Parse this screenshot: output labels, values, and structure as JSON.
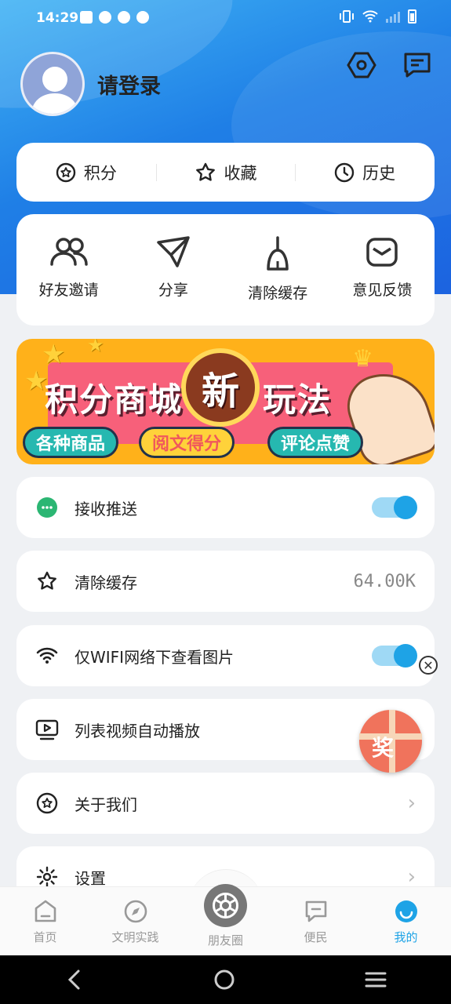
{
  "status_bar": {
    "time": "14:29"
  },
  "profile": {
    "login_text": "请登录"
  },
  "header_icons": [
    "hexagon-settings-icon",
    "message-icon"
  ],
  "quick_tabs": [
    {
      "label": "积分",
      "icon": "star-circle-icon"
    },
    {
      "label": "收藏",
      "icon": "star-icon"
    },
    {
      "label": "历史",
      "icon": "clock-icon"
    }
  ],
  "grid": [
    {
      "label": "好友邀请",
      "icon": "friends-icon"
    },
    {
      "label": "分享",
      "icon": "send-icon"
    },
    {
      "label": "清除缓存",
      "icon": "broom-icon"
    },
    {
      "label": "意见反馈",
      "icon": "mail-bag-icon"
    }
  ],
  "banner": {
    "title_left": "积分商城",
    "title_badge": "新",
    "title_right": "玩法",
    "pills": [
      "各种商品",
      "阅文得分",
      "评论点赞"
    ]
  },
  "settings": [
    {
      "label": "接收推送",
      "icon": "chat-bubble-icon",
      "type": "toggle",
      "on": true
    },
    {
      "label": "清除缓存",
      "icon": "star-icon",
      "type": "value",
      "value": "64.00K"
    },
    {
      "label": "仅WIFI网络下查看图片",
      "icon": "wifi-icon",
      "type": "toggle",
      "on": true
    },
    {
      "label": "列表视频自动播放",
      "icon": "video-icon",
      "type": "none"
    },
    {
      "label": "关于我们",
      "icon": "star-circle-icon",
      "type": "chevron"
    },
    {
      "label": "设置",
      "icon": "gear-icon",
      "type": "chevron"
    }
  ],
  "floating_gift": {
    "label": "奖"
  },
  "tabbar": [
    {
      "label": "首页",
      "icon": "home-icon",
      "active": false
    },
    {
      "label": "文明实践",
      "icon": "compass-icon",
      "active": false
    },
    {
      "label": "朋友圈",
      "icon": "camera-aperture-icon",
      "active": false
    },
    {
      "label": "便民",
      "icon": "message-dots-icon",
      "active": false
    },
    {
      "label": "我的",
      "icon": "smile-icon",
      "active": true
    }
  ],
  "colors": {
    "accent": "#1ea3e6",
    "hero_start": "#3fb2f4",
    "hero_end": "#1c63e0"
  }
}
